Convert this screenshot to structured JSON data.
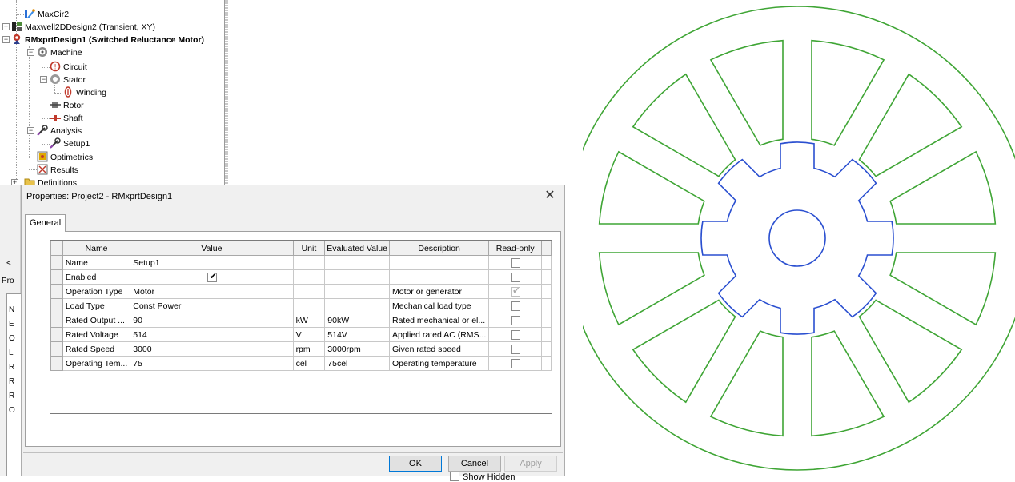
{
  "tree": {
    "items": [
      {
        "label": "MaxCir2",
        "icon": "circuit-design-icon"
      },
      {
        "label": "Maxwell2DDesign2 (Transient, XY)",
        "icon": "maxwell2d-design-icon"
      },
      {
        "label": "RMxprtDesign1 (Switched Reluctance Motor)",
        "icon": "rmxprt-design-icon"
      },
      {
        "label": "Machine",
        "icon": "machine-icon"
      },
      {
        "label": "Circuit",
        "icon": "circuit-icon"
      },
      {
        "label": "Stator",
        "icon": "stator-icon"
      },
      {
        "label": "Winding",
        "icon": "winding-icon"
      },
      {
        "label": "Rotor",
        "icon": "rotor-icon"
      },
      {
        "label": "Shaft",
        "icon": "shaft-icon"
      },
      {
        "label": "Analysis",
        "icon": "analysis-icon"
      },
      {
        "label": "Setup1",
        "icon": "setup-icon"
      },
      {
        "label": "Optimetrics",
        "icon": "optimetrics-icon"
      },
      {
        "label": "Results",
        "icon": "results-icon"
      },
      {
        "label": "Definitions",
        "icon": "folder-icon"
      }
    ]
  },
  "left_pane": {
    "collapse_arrow": "<",
    "tab_partial": "Pro",
    "row_letters": [
      "N",
      "E",
      "O",
      "L",
      "R",
      "R",
      "R",
      "O"
    ]
  },
  "dialog": {
    "title": "Properties: Project2 - RMxprtDesign1",
    "close_glyph": "✕",
    "tab_label": "General",
    "columns": [
      "Name",
      "Value",
      "Unit",
      "Evaluated Value",
      "Description",
      "Read-only"
    ],
    "rows": [
      {
        "name": "Name",
        "value": "Setup1",
        "unit": "",
        "evaluated": "",
        "description": "",
        "value_checkbox": false,
        "readonly_checked": false,
        "readonly_dim": false
      },
      {
        "name": "Enabled",
        "value": "",
        "unit": "",
        "evaluated": "",
        "description": "",
        "value_checkbox": true,
        "value_checked": true,
        "readonly_checked": false,
        "readonly_dim": false
      },
      {
        "name": "Operation Type",
        "value": "Motor",
        "unit": "",
        "evaluated": "",
        "description": "Motor or generator",
        "value_checkbox": false,
        "readonly_checked": true,
        "readonly_dim": true
      },
      {
        "name": "Load Type",
        "value": "Const Power",
        "unit": "",
        "evaluated": "",
        "description": "Mechanical load type",
        "value_checkbox": false,
        "readonly_checked": false,
        "readonly_dim": false
      },
      {
        "name": "Rated Output ...",
        "value": "90",
        "unit": "kW",
        "evaluated": "90kW",
        "description": "Rated mechanical or el...",
        "value_checkbox": false,
        "readonly_checked": false,
        "readonly_dim": false
      },
      {
        "name": "Rated Voltage",
        "value": "514",
        "unit": "V",
        "evaluated": "514V",
        "description": "Applied rated AC (RMS...",
        "value_checkbox": false,
        "readonly_checked": false,
        "readonly_dim": false
      },
      {
        "name": "Rated Speed",
        "value": "3000",
        "unit": "rpm",
        "evaluated": "3000rpm",
        "description": "Given rated speed",
        "value_checkbox": false,
        "readonly_checked": false,
        "readonly_dim": false
      },
      {
        "name": "Operating Tem...",
        "value": "75",
        "unit": "cel",
        "evaluated": "75cel",
        "description": "Operating temperature",
        "value_checkbox": false,
        "readonly_checked": false,
        "readonly_dim": false
      }
    ],
    "show_hidden_label": "Show Hidden",
    "show_hidden_checked": false,
    "ok_label": "OK",
    "cancel_label": "Cancel",
    "apply_label": "Apply"
  },
  "motor_view": {
    "stator_color": "#3fa535",
    "rotor_color": "#2a4fd0",
    "stator_poles": 12,
    "rotor_poles": 8
  }
}
